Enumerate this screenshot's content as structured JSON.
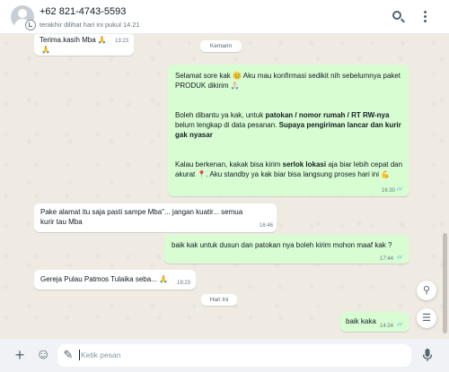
{
  "header": {
    "contact_name": "+62 821-4743-5593",
    "last_seen": "terakhir dilihat hari ini pukul 14.21",
    "icons": [
      "avatar",
      "search-icon",
      "menu-icon"
    ]
  },
  "messages": {
    "m1": {
      "text": "Terima.kasih  Mba 🙏",
      "emoji": "🙏",
      "time": "13:23"
    },
    "day1": "Kemarin",
    "m2": {
      "p1": "Selamat sore kak 😊 Aku mau konfirmasi sedikit nih sebelumnya paket PRODUK dikirim 🙏🏻",
      "p2_a": "Boleh dibantu ya kak, untuk ",
      "p2_bold1": "patokan / nomor rumah / RT RW-nya",
      "p2_b": " belum lengkap di data pesanan.  ",
      "p2_bold2": "Supaya pengiriman lancar dan kurir gak nyasar",
      "p3_a": "Kalau berkenan, kakak bisa kirim ",
      "p3_bold": "serlok lokasi",
      "p3_b": " aja biar lebih cepat dan akurat 📍.  Aku standby ya kak biar bisa langsung proses hari ini 💪",
      "time": "16:30"
    },
    "m3": {
      "text": "Pake alamat itu saja pasti sampe Mba\"... jangan kuatir... semua kurir tau Mba",
      "time": "16:46"
    },
    "m4": {
      "text": "baik kak untuk dusun dan patokan nya boleh kirim mohon maaf kak ?",
      "time": "17:44"
    },
    "m5": {
      "text": "Gereja Pulau Patmos  Tulaika  seba... 🙏",
      "time": "19:23"
    },
    "day2": "Hari Ini",
    "m6": {
      "text": "baik kaka",
      "time": "14:24"
    }
  },
  "composer": {
    "placeholder": "Ketik pesan",
    "icons": [
      "plus-icon",
      "emoji-icon",
      "sticker-icon",
      "mic-icon"
    ]
  },
  "colors": {
    "incoming": "#ffffff",
    "outgoing": "#d9fdd3",
    "background": "#efeae2",
    "read_ticks": "#53bdeb"
  }
}
